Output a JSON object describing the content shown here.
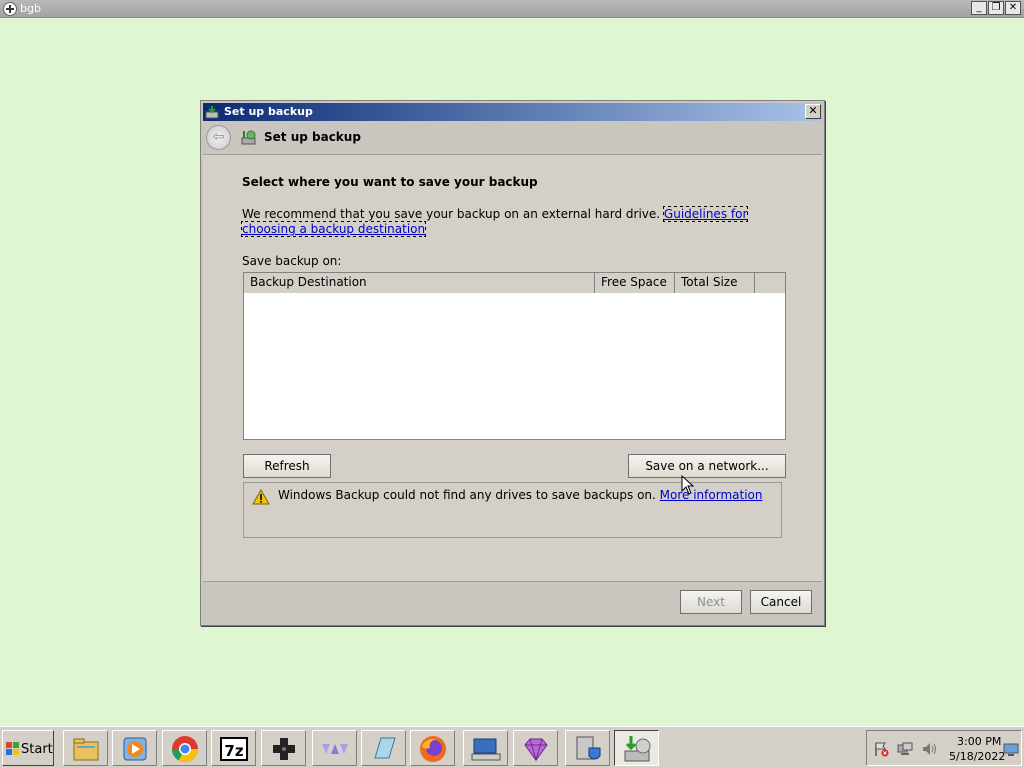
{
  "outer_window": {
    "title": "bgb",
    "buttons": {
      "minimize": "_",
      "restore": "❐",
      "close": "✕"
    }
  },
  "dialog": {
    "title": "Set up backup",
    "close_glyph": "✕",
    "nav": {
      "back_glyph": "⇦",
      "title": "Set up backup"
    },
    "heading": "Select where you want to save your backup",
    "recommend_text": "We recommend that you save your backup on an external hard drive. ",
    "guidelines_link": "Guidelines for choosing a backup destination",
    "save_on_label": "Save backup on:",
    "columns": [
      "Backup Destination",
      "Free Space",
      "Total Size",
      ""
    ],
    "rows": [],
    "refresh_button": "Refresh",
    "network_button": "Save on a network...",
    "warning_text": "Windows Backup could not find any drives to save backups on. ",
    "more_info_link": "More information",
    "next_button": "Next",
    "cancel_button": "Cancel"
  },
  "taskbar": {
    "start_label": "Start",
    "items": [
      {
        "icon": "file-explorer-icon"
      },
      {
        "icon": "media-player-icon"
      },
      {
        "icon": "chrome-icon"
      },
      {
        "icon": "7zip-icon",
        "text": "7z"
      },
      {
        "icon": "gamepad-icon"
      },
      {
        "icon": "triangles-icon"
      },
      {
        "icon": "notepad-icon"
      },
      {
        "icon": "firefox-icon"
      },
      {
        "icon": "keyboard-icon"
      },
      {
        "icon": "gem-icon"
      },
      {
        "icon": "security-icon"
      },
      {
        "icon": "backup-icon",
        "active": true
      }
    ],
    "tray": {
      "time": "3:00 PM",
      "date": "5/18/2022"
    }
  },
  "colors": {
    "desktop": "#dff6d2",
    "title_gradient_start": "#0b2a74",
    "title_gradient_end": "#a7c3e9",
    "link": "#0000cc",
    "warning_yellow": "#f5c400"
  }
}
